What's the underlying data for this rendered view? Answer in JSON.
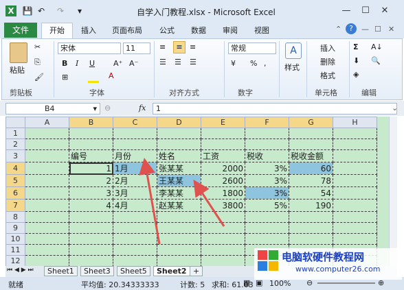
{
  "window": {
    "title": "自学入门教程.xlsx - Microsoft Excel",
    "min": "—",
    "max": "☐",
    "close": "✕"
  },
  "tabs": {
    "file": "文件",
    "home": "开始",
    "insert": "插入",
    "layout": "页面布局",
    "formulas": "公式",
    "data": "数据",
    "review": "审阅",
    "view": "视图"
  },
  "ribbon": {
    "paste": "粘贴",
    "clipboard": "剪贴板",
    "font_name": "宋体",
    "font_size": "11",
    "font_group": "字体",
    "align_group": "对齐方式",
    "number_format": "常规",
    "number_group": "数字",
    "styles": "样式",
    "insert": "插入",
    "delete": "删除",
    "format": "格式",
    "cells_group": "单元格",
    "edit_group": "编辑",
    "bold": "B",
    "italic": "I",
    "underline": "U"
  },
  "formula_bar": {
    "name_box": "B4",
    "fx": "fx",
    "value": "1"
  },
  "columns": [
    "A",
    "B",
    "C",
    "D",
    "E",
    "F",
    "G",
    "H"
  ],
  "rows": [
    {
      "n": "1",
      "cells": [
        "",
        "",
        "",
        "",
        "",
        "",
        "",
        ""
      ]
    },
    {
      "n": "2",
      "cells": [
        "",
        "",
        "",
        "",
        "",
        "",
        "",
        ""
      ]
    },
    {
      "n": "3",
      "cells": [
        "",
        "编号",
        "月份",
        "姓名",
        "工资",
        "税收",
        "税收金额",
        ""
      ]
    },
    {
      "n": "4",
      "cells": [
        "",
        "1",
        "1月",
        "张某某",
        "2000",
        "3%",
        "60",
        ""
      ]
    },
    {
      "n": "5",
      "cells": [
        "",
        "2",
        "2月",
        "王某某",
        "2600",
        "3%",
        "78",
        ""
      ]
    },
    {
      "n": "6",
      "cells": [
        "",
        "3",
        "3月",
        "李某某",
        "1800",
        "3%",
        "54",
        ""
      ]
    },
    {
      "n": "7",
      "cells": [
        "",
        "4",
        "4月",
        "赵某某",
        "3800",
        "5%",
        "190",
        ""
      ]
    },
    {
      "n": "8",
      "cells": [
        "",
        "",
        "",
        "",
        "",
        "",
        "",
        ""
      ]
    },
    {
      "n": "9",
      "cells": [
        "",
        "",
        "",
        "",
        "",
        "",
        "",
        ""
      ]
    },
    {
      "n": "10",
      "cells": [
        "",
        "",
        "",
        "",
        "",
        "",
        "",
        ""
      ]
    },
    {
      "n": "11",
      "cells": [
        "",
        "",
        "",
        "",
        "",
        "",
        "",
        ""
      ]
    },
    {
      "n": "12",
      "cells": [
        "",
        "",
        "",
        "",
        "",
        "",
        "",
        ""
      ]
    },
    {
      "n": "13",
      "cells": [
        "",
        "",
        "",
        "",
        "",
        "",
        "",
        ""
      ]
    }
  ],
  "sheets": [
    "Sheet1",
    "Sheet3",
    "Sheet5",
    "Sheet2"
  ],
  "status": {
    "mode": "就绪",
    "average": "平均值: 20.34333333",
    "count": "计数: 5",
    "sum": "求和: 61.03",
    "zoom": "100%"
  },
  "watermark": {
    "line1": "电脑软硬件教程网",
    "line2": "www.computer26.com"
  },
  "colors": {
    "grid_bg": "#c7e9cc",
    "highlight": "#8ec4dd",
    "arrow": "#e0524d",
    "file_tab": "#2a8a43"
  }
}
